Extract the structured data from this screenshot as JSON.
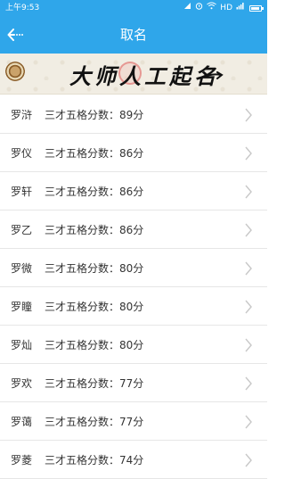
{
  "status_bar": {
    "time": "上午9:53",
    "network": "HD",
    "icons": [
      "signal-icon",
      "alarm-icon",
      "wifi-icon",
      "cellular-icon",
      "battery-icon"
    ]
  },
  "app_bar": {
    "back_icon": "back-arrow-icon",
    "title": "取名"
  },
  "banner": {
    "text": "大师人工起名"
  },
  "list": {
    "items": [
      {
        "name": "罗浒",
        "score_text": "三才五格分数：89分"
      },
      {
        "name": "罗仪",
        "score_text": "三才五格分数：86分"
      },
      {
        "name": "罗轩",
        "score_text": "三才五格分数：86分"
      },
      {
        "name": "罗乙",
        "score_text": "三才五格分数：86分"
      },
      {
        "name": "罗微",
        "score_text": "三才五格分数：80分"
      },
      {
        "name": "罗瞳",
        "score_text": "三才五格分数：80分"
      },
      {
        "name": "罗灿",
        "score_text": "三才五格分数：80分"
      },
      {
        "name": "罗欢",
        "score_text": "三才五格分数：77分"
      },
      {
        "name": "罗蔼",
        "score_text": "三才五格分数：77分"
      },
      {
        "name": "罗菱",
        "score_text": "三才五格分数：74分"
      }
    ]
  },
  "colors": {
    "primary": "#2fa6ea",
    "banner_bg": "#f1ede3",
    "text": "#333333",
    "divider": "#e6e6e6",
    "chevron": "#c8c8c8"
  }
}
